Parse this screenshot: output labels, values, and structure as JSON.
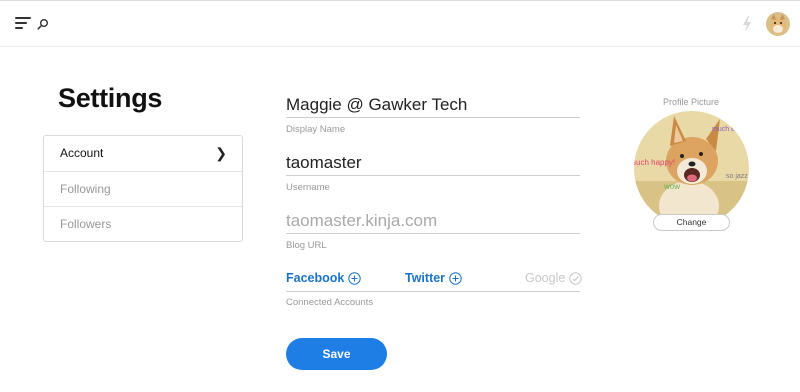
{
  "header": {
    "menu_icon": "hamburger-icon",
    "search_icon": "search-icon",
    "bolt_icon": "bolt-icon"
  },
  "page": {
    "title": "Settings"
  },
  "sidebar": {
    "items": [
      {
        "label": "Account",
        "active": true
      },
      {
        "label": "Following",
        "active": false
      },
      {
        "label": "Followers",
        "active": false
      }
    ]
  },
  "form": {
    "display_name": {
      "value": "Maggie @ Gawker Tech",
      "caption": "Display Name"
    },
    "username": {
      "value": "taomaster",
      "caption": "Username"
    },
    "blog_url": {
      "placeholder": "taomaster.kinja.com",
      "caption": "Blog URL"
    },
    "connected": {
      "facebook": "Facebook",
      "twitter": "Twitter",
      "google": "Google",
      "caption": "Connected Accounts"
    },
    "save_label": "Save"
  },
  "profile": {
    "label": "Profile Picture",
    "change_label": "Change",
    "image_texts": [
      "such happy!",
      "wow",
      "much EX",
      "so jazz"
    ]
  },
  "colors": {
    "accent": "#1f7de6",
    "link": "#1a73c9"
  }
}
